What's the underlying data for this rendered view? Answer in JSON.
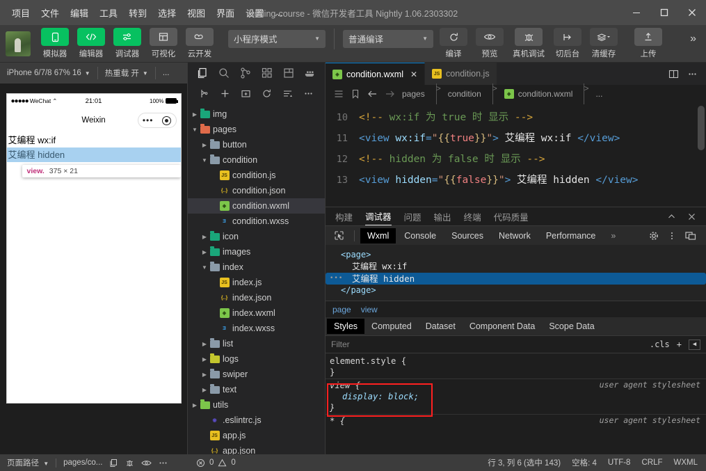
{
  "titlebar": {
    "menu": [
      "项目",
      "文件",
      "编辑",
      "工具",
      "转到",
      "选择",
      "视图",
      "界面",
      "设置",
      "..."
    ],
    "window_title": "icoding-course - 微信开发者工具 Nightly 1.06.2303302",
    "minimize": "—",
    "maximize": "□",
    "close": "✕"
  },
  "toolbar": {
    "buttons": [
      {
        "label": "模拟器",
        "icon": "simulator-icon",
        "style": "green"
      },
      {
        "label": "编辑器",
        "icon": "code-icon",
        "style": "green"
      },
      {
        "label": "调试器",
        "icon": "debugger-icon",
        "style": "green"
      },
      {
        "label": "可视化",
        "icon": "layout-icon",
        "style": "grey"
      },
      {
        "label": "云开发",
        "icon": "cloud-icon",
        "style": "grey"
      }
    ],
    "mode_select": "小程序模式",
    "compile_select": "普通编译",
    "actions": [
      {
        "label": "编译",
        "icon": "refresh-icon"
      },
      {
        "label": "预览",
        "icon": "eye-icon"
      },
      {
        "label": "真机调试",
        "icon": "bug-icon"
      },
      {
        "label": "切后台",
        "icon": "background-icon"
      },
      {
        "label": "清缓存",
        "icon": "layers-icon"
      },
      {
        "label": "上传",
        "icon": "upload-icon"
      }
    ],
    "overflow": "»"
  },
  "simulator": {
    "device": "iPhone 6/7/8 67% 16",
    "hot_reload": "热重载 开",
    "more": "...",
    "phone": {
      "signal": "●●●●●",
      "carrier": "WeChat",
      "wifi": "⌃",
      "time": "21:01",
      "battery_pct": "100%",
      "nav_title": "Weixin",
      "rows": [
        {
          "text": "艾编程 wx:if",
          "highlight": false
        },
        {
          "text": "艾编程 hidden",
          "highlight": true
        }
      ],
      "tooltip_tag": "view.",
      "tooltip_size": "375 × 21"
    }
  },
  "explorer": {
    "icons": [
      "files-icon",
      "search-icon",
      "source-control-icon",
      "extensions-icon",
      "save-icon",
      "docker-icon"
    ],
    "actions": [
      "new-file-icon",
      "new-folder-icon",
      "add-folder-icon",
      "refresh-icon",
      "collapse-icon",
      "more-icon"
    ],
    "tree": [
      {
        "name": "img",
        "type": "folder-img",
        "depth": 0,
        "arrow": "right"
      },
      {
        "name": "pages",
        "type": "folder-pages",
        "depth": 0,
        "arrow": "down"
      },
      {
        "name": "button",
        "type": "folder",
        "depth": 1,
        "arrow": "right"
      },
      {
        "name": "condition",
        "type": "folder",
        "depth": 1,
        "arrow": "down"
      },
      {
        "name": "condition.js",
        "type": "js",
        "depth": 2,
        "arrow": ""
      },
      {
        "name": "condition.json",
        "type": "json",
        "depth": 2,
        "arrow": ""
      },
      {
        "name": "condition.wxml",
        "type": "wxml",
        "depth": 2,
        "arrow": "",
        "selected": true
      },
      {
        "name": "condition.wxss",
        "type": "wxss",
        "depth": 2,
        "arrow": ""
      },
      {
        "name": "icon",
        "type": "folder-img",
        "depth": 1,
        "arrow": "right"
      },
      {
        "name": "images",
        "type": "folder-img",
        "depth": 1,
        "arrow": "right"
      },
      {
        "name": "index",
        "type": "folder",
        "depth": 1,
        "arrow": "down"
      },
      {
        "name": "index.js",
        "type": "js",
        "depth": 2,
        "arrow": ""
      },
      {
        "name": "index.json",
        "type": "json",
        "depth": 2,
        "arrow": ""
      },
      {
        "name": "index.wxml",
        "type": "wxml",
        "depth": 2,
        "arrow": ""
      },
      {
        "name": "index.wxss",
        "type": "wxss",
        "depth": 2,
        "arrow": ""
      },
      {
        "name": "list",
        "type": "folder",
        "depth": 1,
        "arrow": "right"
      },
      {
        "name": "logs",
        "type": "folder-logs",
        "depth": 1,
        "arrow": "right"
      },
      {
        "name": "swiper",
        "type": "folder",
        "depth": 1,
        "arrow": "right"
      },
      {
        "name": "text",
        "type": "folder",
        "depth": 1,
        "arrow": "right"
      },
      {
        "name": "utils",
        "type": "folder-utils",
        "depth": 0,
        "arrow": "right"
      },
      {
        "name": ".eslintrc.js",
        "type": "eslint",
        "depth": 1,
        "arrow": ""
      },
      {
        "name": "app.js",
        "type": "js",
        "depth": 1,
        "arrow": ""
      },
      {
        "name": "app.json",
        "type": "json",
        "depth": 1,
        "arrow": ""
      }
    ]
  },
  "editor": {
    "tabs": [
      {
        "label": "condition.wxml",
        "type": "wxml",
        "active": true,
        "close": "✕"
      },
      {
        "label": "condition.js",
        "type": "js",
        "active": false
      }
    ],
    "tab_actions": [
      "split-editor-icon",
      "more-icon"
    ],
    "breadcrumb": [
      "pages",
      "condition",
      "condition.wxml",
      "..."
    ],
    "breadcrumb_actions": [
      "outline-icon",
      "bookmark-icon",
      "back-icon",
      "forward-icon"
    ],
    "lines": [
      {
        "num": "10",
        "text": "<!-- wx:if 为 true 时 显示 -->"
      },
      {
        "num": "11",
        "text": "<view wx:if=\"{{true}}\"> 艾编程 wx:if </view>"
      },
      {
        "num": "12",
        "text": "<!-- hidden 为 false 时 显示 -->"
      },
      {
        "num": "13",
        "text": "<view hidden=\"{{false}}\"> 艾编程 hidden </view>"
      }
    ]
  },
  "debugger": {
    "panel_tabs": [
      "构建",
      "调试器",
      "问题",
      "输出",
      "终端",
      "代码质量"
    ],
    "panel_active": "调试器",
    "panel_actions": [
      "collapse-icon",
      "close-icon"
    ],
    "devtools_tabs": [
      "Wxml",
      "Console",
      "Sources",
      "Network",
      "Performance"
    ],
    "devtools_active": "Wxml",
    "devtools_overflow": "»",
    "devtools_right": [
      "settings-gear-icon",
      "more-vertical-icon",
      "dock-icon"
    ],
    "inspect_icon": "inspect-cursor-icon",
    "wxml_tree": [
      {
        "text": "<page>",
        "indent": 0,
        "selected": false
      },
      {
        "text": "<view> 艾编程 wx:if </view>",
        "indent": 1,
        "selected": false
      },
      {
        "text": "<view> 艾编程 hidden </view>",
        "indent": 1,
        "selected": true
      },
      {
        "text": "</page>",
        "indent": 0,
        "selected": false
      }
    ],
    "node_crumb": [
      "page",
      "view"
    ],
    "style_tabs": [
      "Styles",
      "Computed",
      "Dataset",
      "Component Data",
      "Scope Data"
    ],
    "style_active": "Styles",
    "filter_placeholder": "Filter",
    "cls_label": ".cls",
    "plus_label": "+",
    "rules": [
      {
        "selector": "element.style {",
        "props": [],
        "close": "}",
        "source": "",
        "highlighted": false
      },
      {
        "selector": "view {",
        "props": [
          "display: block;"
        ],
        "close": "}",
        "source": "user agent stylesheet",
        "highlighted": true
      },
      {
        "selector": "* {",
        "props": [],
        "close": "",
        "source": "user agent stylesheet",
        "highlighted": false
      }
    ]
  },
  "statusbar": {
    "page_path_label": "页面路径",
    "page_path_value": "pages/co...",
    "left_icons": [
      "copy-icon",
      "bug-icon",
      "eye-icon",
      "more-icon"
    ],
    "errors": "0",
    "warnings": "0",
    "cursor": "行 3, 列 6 (选中 143)",
    "indent": "空格: 4",
    "encoding": "UTF-8",
    "eol": "CRLF",
    "language": "WXML"
  }
}
